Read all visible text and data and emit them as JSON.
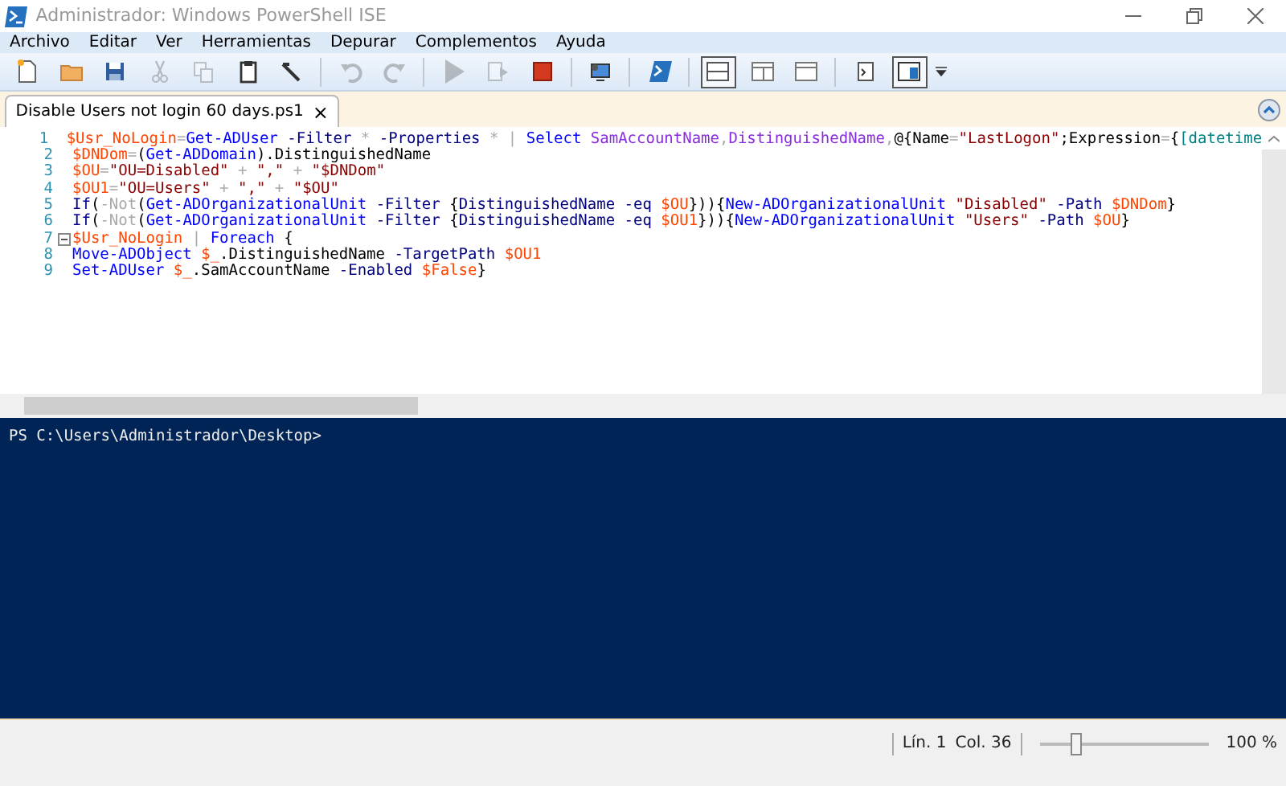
{
  "window": {
    "title": "Administrador: Windows PowerShell ISE"
  },
  "menu": [
    "Archivo",
    "Editar",
    "Ver",
    "Herramientas",
    "Depurar",
    "Complementos",
    "Ayuda"
  ],
  "toolbar": [
    {
      "disabled": false,
      "selected": false
    },
    {
      "disabled": false,
      "selected": false
    },
    {
      "disabled": false,
      "selected": false
    },
    {
      "disabled": true,
      "selected": false
    },
    {
      "disabled": true,
      "selected": false
    },
    {
      "disabled": false,
      "selected": false
    },
    {
      "disabled": false,
      "selected": false
    },
    {
      "disabled": true,
      "selected": false
    },
    {
      "disabled": true,
      "selected": false
    },
    {
      "disabled": true,
      "selected": false
    },
    {
      "disabled": true,
      "selected": false
    },
    {
      "disabled": false,
      "selected": false
    },
    {
      "disabled": false,
      "selected": false
    },
    {
      "disabled": false,
      "selected": false
    },
    {
      "disabled": false,
      "selected": true
    },
    {
      "disabled": false,
      "selected": false
    },
    {
      "disabled": false,
      "selected": false
    },
    {
      "disabled": false,
      "selected": false
    },
    {
      "disabled": false,
      "selected": true
    }
  ],
  "tabs": [
    {
      "label": "Disable Users not login 60 days.ps1",
      "close": "×",
      "selected": true
    }
  ],
  "editor": {
    "lines": [
      {
        "number": "1",
        "fold": false,
        "tokens": [
          {
            "kind": "variable",
            "text": "$Usr_NoLogin"
          },
          {
            "kind": "operator",
            "text": "="
          },
          {
            "kind": "command",
            "text": "Get-ADUser "
          },
          {
            "kind": "parameter",
            "text": "-Filter "
          },
          {
            "kind": "operator",
            "text": "* "
          },
          {
            "kind": "parameter",
            "text": "-Properties "
          },
          {
            "kind": "operator",
            "text": "* | "
          },
          {
            "kind": "command",
            "text": "Select "
          },
          {
            "kind": "argument",
            "text": "SamAccountName"
          },
          {
            "kind": "operator",
            "text": ","
          },
          {
            "kind": "argument",
            "text": "DistinguishedName"
          },
          {
            "kind": "operator",
            "text": ","
          },
          {
            "kind": "plain",
            "text": "@{Name"
          },
          {
            "kind": "operator",
            "text": "="
          },
          {
            "kind": "string",
            "text": "\"LastLogon\""
          },
          {
            "kind": "plain",
            "text": ";Expression"
          },
          {
            "kind": "operator",
            "text": "="
          },
          {
            "kind": "plain",
            "text": "{"
          },
          {
            "kind": "type",
            "text": "[datetime"
          }
        ]
      },
      {
        "number": "2",
        "fold": false,
        "tokens": [
          {
            "kind": "variable",
            "text": "$DNDom"
          },
          {
            "kind": "operator",
            "text": "="
          },
          {
            "kind": "plain",
            "text": "("
          },
          {
            "kind": "command",
            "text": "Get-ADDomain"
          },
          {
            "kind": "plain",
            "text": ").DistinguishedName"
          }
        ]
      },
      {
        "number": "3",
        "fold": false,
        "tokens": [
          {
            "kind": "variable",
            "text": "$OU"
          },
          {
            "kind": "operator",
            "text": "="
          },
          {
            "kind": "string",
            "text": "\"OU=Disabled\" "
          },
          {
            "kind": "operator",
            "text": "+ "
          },
          {
            "kind": "string",
            "text": "\",\" "
          },
          {
            "kind": "operator",
            "text": "+ "
          },
          {
            "kind": "string",
            "text": "\"$DNDom\""
          }
        ]
      },
      {
        "number": "4",
        "fold": false,
        "tokens": [
          {
            "kind": "variable",
            "text": "$OU1"
          },
          {
            "kind": "operator",
            "text": "="
          },
          {
            "kind": "string",
            "text": "\"OU=Users\" "
          },
          {
            "kind": "operator",
            "text": "+ "
          },
          {
            "kind": "string",
            "text": "\",\" "
          },
          {
            "kind": "operator",
            "text": "+ "
          },
          {
            "kind": "string",
            "text": "\"$OU\""
          }
        ]
      },
      {
        "number": "5",
        "fold": false,
        "tokens": [
          {
            "kind": "keyword",
            "text": "If"
          },
          {
            "kind": "plain",
            "text": "("
          },
          {
            "kind": "operator",
            "text": "-Not"
          },
          {
            "kind": "plain",
            "text": "("
          },
          {
            "kind": "command",
            "text": "Get-ADOrganizationalUnit "
          },
          {
            "kind": "parameter",
            "text": "-Filter "
          },
          {
            "kind": "plain",
            "text": "{"
          },
          {
            "kind": "parameter",
            "text": "DistinguishedName -eq "
          },
          {
            "kind": "variable",
            "text": "$OU"
          },
          {
            "kind": "plain",
            "text": "})){"
          },
          {
            "kind": "command",
            "text": "New-ADOrganizationalUnit "
          },
          {
            "kind": "string",
            "text": "\"Disabled\" "
          },
          {
            "kind": "parameter",
            "text": "-Path "
          },
          {
            "kind": "variable",
            "text": "$DNDom"
          },
          {
            "kind": "plain",
            "text": "}"
          }
        ]
      },
      {
        "number": "6",
        "fold": false,
        "tokens": [
          {
            "kind": "keyword",
            "text": "If"
          },
          {
            "kind": "plain",
            "text": "("
          },
          {
            "kind": "operator",
            "text": "-Not"
          },
          {
            "kind": "plain",
            "text": "("
          },
          {
            "kind": "command",
            "text": "Get-ADOrganizationalUnit "
          },
          {
            "kind": "parameter",
            "text": "-Filter "
          },
          {
            "kind": "plain",
            "text": "{"
          },
          {
            "kind": "parameter",
            "text": "DistinguishedName -eq "
          },
          {
            "kind": "variable",
            "text": "$OU1"
          },
          {
            "kind": "plain",
            "text": "})){"
          },
          {
            "kind": "command",
            "text": "New-ADOrganizationalUnit "
          },
          {
            "kind": "string",
            "text": "\"Users\" "
          },
          {
            "kind": "parameter",
            "text": "-Path "
          },
          {
            "kind": "variable",
            "text": "$OU"
          },
          {
            "kind": "plain",
            "text": "}"
          }
        ]
      },
      {
        "number": "7",
        "fold": true,
        "tokens": [
          {
            "kind": "variable",
            "text": "$Usr_NoLogin "
          },
          {
            "kind": "operator",
            "text": "| "
          },
          {
            "kind": "command",
            "text": "Foreach "
          },
          {
            "kind": "plain",
            "text": "{"
          }
        ]
      },
      {
        "number": "8",
        "fold": false,
        "tokens": [
          {
            "kind": "command",
            "text": "Move-ADObject "
          },
          {
            "kind": "variable",
            "text": "$_"
          },
          {
            "kind": "plain",
            "text": ".DistinguishedName "
          },
          {
            "kind": "parameter",
            "text": "-TargetPath "
          },
          {
            "kind": "variable",
            "text": "$OU1"
          }
        ]
      },
      {
        "number": "9",
        "fold": false,
        "tokens": [
          {
            "kind": "command",
            "text": "Set-ADUser "
          },
          {
            "kind": "variable",
            "text": "$_"
          },
          {
            "kind": "plain",
            "text": ".SamAccountName "
          },
          {
            "kind": "parameter",
            "text": "-Enabled "
          },
          {
            "kind": "variable",
            "text": "$False"
          },
          {
            "kind": "plain",
            "text": "}"
          }
        ]
      }
    ]
  },
  "console": {
    "prompt": "PS C:\\Users\\Administrador\\Desktop>"
  },
  "status_bar": {
    "line": "Lín. 1",
    "column": "Col. 36",
    "zoom": {
      "level": 0.2
    },
    "zoom_text": "100 %"
  }
}
